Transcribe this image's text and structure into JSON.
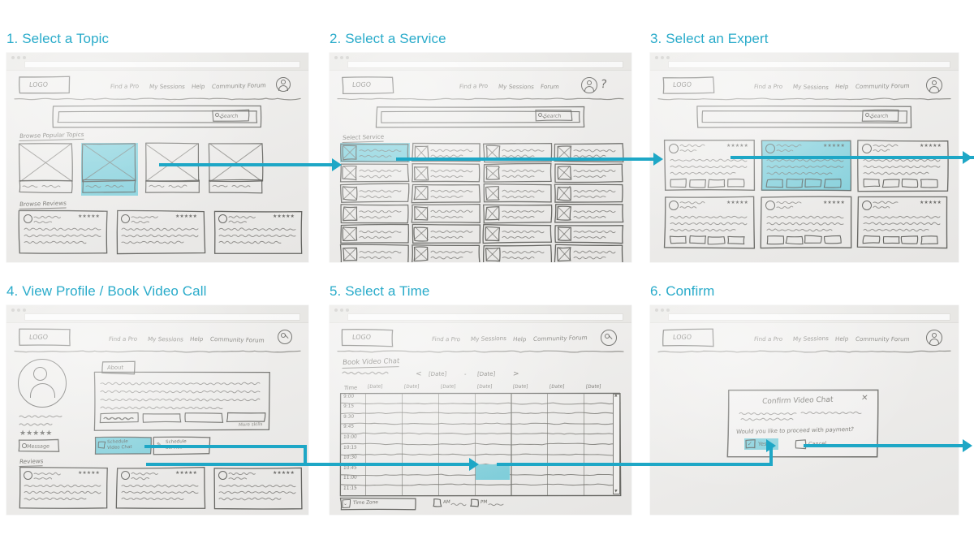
{
  "meta": {
    "accent": "#29abca",
    "arrow_color": "#1ea7c6",
    "highlight": "#7bd0dd",
    "ink": "#4a4a46",
    "paper": "#efeeec",
    "canvas": "#ffffff"
  },
  "panels": [
    {
      "id": "panel-1",
      "number": "1.",
      "title": "1. Select a Topic",
      "logo": "LOGO",
      "nav": [
        "Find a Pro",
        "My Sessions",
        "Help",
        "Community Forum"
      ],
      "avatar_icon": "user-avatar-icon",
      "search_button": "Search",
      "search_icon": "magnifier-icon",
      "sections": [
        {
          "heading": "Browse Popular Topics",
          "tiles": 4,
          "selected_index": 1
        },
        {
          "heading": "Browse Reviews",
          "cards": 3
        }
      ]
    },
    {
      "id": "panel-2",
      "number": "2.",
      "title": "2. Select a Service",
      "logo": "LOGO",
      "nav": [
        "Find a Pro",
        "My Sessions",
        "Forum"
      ],
      "avatar_icon": "user-avatar-icon",
      "help_icon": "question-mark-icon",
      "search_button": "Search",
      "search_icon": "magnifier-icon",
      "sections": [
        {
          "heading": "Select Service",
          "columns": 4,
          "rows": 6,
          "selected_cell": "r0c0"
        }
      ]
    },
    {
      "id": "panel-3",
      "number": "3.",
      "title": "3. Select an Expert",
      "logo": "LOGO",
      "nav": [
        "Find a Pro",
        "My Sessions",
        "Help",
        "Community Forum"
      ],
      "avatar_icon": "user-avatar-icon",
      "search_button": "Search",
      "search_icon": "magnifier-icon",
      "sections": [
        {
          "heading": "",
          "columns": 3,
          "rows": 3,
          "selected_cell": "r0c1",
          "card_type": "expert-card"
        }
      ]
    },
    {
      "id": "panel-4",
      "number": "4.",
      "title": "4. View Profile / Book Video Call",
      "logo": "LOGO",
      "nav": [
        "Find a Pro",
        "My Sessions",
        "Help",
        "Community Forum"
      ],
      "avatar_icon": "search-avatar-icon",
      "profile": {
        "avatar_icon": "large-profile-avatar-icon",
        "name_placeholder": "Name",
        "rating_stars": 5,
        "message_button": "Message",
        "message_icon": "chat-bubble-icon",
        "about_tab": "About",
        "more_skills_link": "More skills",
        "skill_chips": 4
      },
      "actions": [
        {
          "label": "Schedule Video Chat",
          "icon": "video-camera-icon",
          "selected": true
        },
        {
          "label": "Schedule Service",
          "icon": "wrench-icon",
          "selected": false
        }
      ],
      "sections": [
        {
          "heading": "Reviews",
          "cards": 3
        }
      ]
    },
    {
      "id": "panel-5",
      "number": "5.",
      "title": "5. Select a Time",
      "logo": "LOGO",
      "nav": [
        "Find a Pro",
        "My Sessions",
        "Help",
        "Community Forum"
      ],
      "avatar_icon": "search-icon",
      "page_heading": "Book Video Chat",
      "date_nav": {
        "prev_icon": "chevron-left-icon",
        "next_icon": "chevron-right-icon",
        "start": "[Date]",
        "separator": "-",
        "end": "[Date]"
      },
      "table": {
        "time_header": "Time",
        "date_headers": [
          "[Date]",
          "[Date]",
          "[Date]",
          "[Date]",
          "[Date]",
          "[Date]",
          "[Date]"
        ],
        "times": [
          "9:00",
          "9:15",
          "9:30",
          "9:45",
          "10:00",
          "10:15",
          "10:30",
          "10:45",
          "11:00",
          "11:15"
        ],
        "selected_slot": {
          "row": "10:45",
          "col": 3
        },
        "scroll_up_icon": "caret-up-icon",
        "scroll_down_icon": "caret-down-icon"
      },
      "footer": {
        "timezone_select": "Time Zone",
        "timezone_icon": "chevron-down-icon",
        "checkboxes": [
          "AM",
          "PM"
        ]
      }
    },
    {
      "id": "panel-6",
      "number": "6.",
      "title": "6. Confirm",
      "logo": "LOGO",
      "nav": [
        "Find a Pro",
        "My Sessions",
        "Help",
        "Community Forum"
      ],
      "avatar_icon": "user-avatar-icon",
      "modal": {
        "title": "Confirm Video Chat",
        "close_icon": "close-x-icon",
        "question": "Would you like to proceed with payment?",
        "options": [
          {
            "label": "Yes",
            "icon": "checkbox-checked-icon",
            "selected": true
          },
          {
            "label": "Cancel",
            "icon": "checkbox-icon",
            "selected": false
          }
        ]
      }
    }
  ],
  "flow_arrows": [
    {
      "id": "arrow-1-to-2",
      "from": "panel-1",
      "to": "panel-2",
      "direction": "right"
    },
    {
      "id": "arrow-2-to-3",
      "from": "panel-2",
      "to": "panel-3",
      "direction": "right"
    },
    {
      "id": "arrow-3-out",
      "from": "panel-3",
      "to": "panel-4",
      "direction": "right"
    },
    {
      "id": "arrow-4-to-5",
      "from": "panel-4",
      "to": "panel-5",
      "direction": "right"
    },
    {
      "id": "arrow-5-to-6",
      "from": "panel-5",
      "to": "panel-6",
      "direction": "right"
    },
    {
      "id": "arrow-6-out",
      "from": "panel-6",
      "to": "end",
      "direction": "right"
    }
  ]
}
